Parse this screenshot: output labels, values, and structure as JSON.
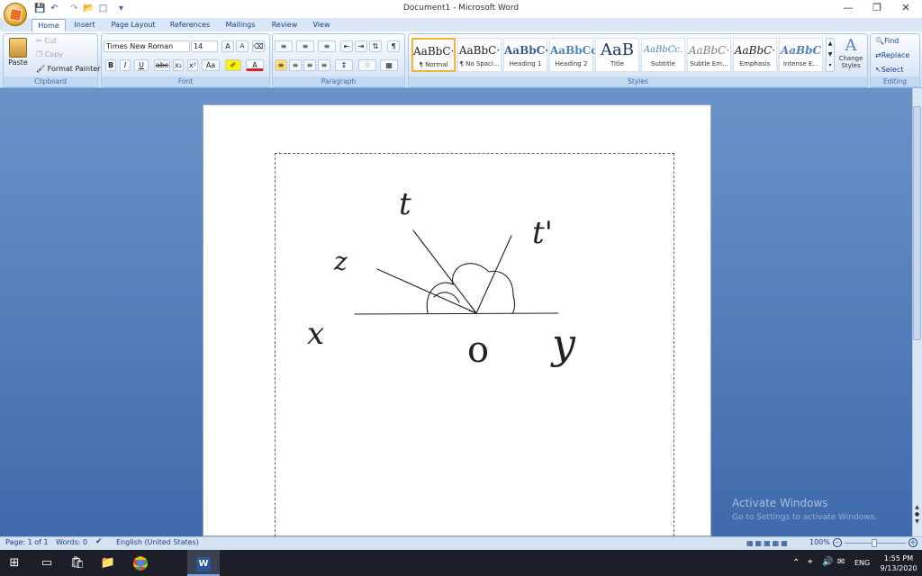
{
  "window": {
    "title": "Document1 - Microsoft Word"
  },
  "tabs": [
    "Home",
    "Insert",
    "Page Layout",
    "References",
    "Mailings",
    "Review",
    "View"
  ],
  "clipboard": {
    "paste": "Paste",
    "cut": "Cut",
    "copy": "Copy",
    "format_painter": "Format Painter",
    "label": "Clipboard"
  },
  "font": {
    "name": "Times New Roman",
    "size": "14",
    "label": "Font"
  },
  "paragraph": {
    "label": "Paragraph"
  },
  "styles": {
    "label": "Styles",
    "tiles": [
      {
        "sample": "AaBbC·",
        "name": "¶ Normal"
      },
      {
        "sample": "AaBbC·",
        "name": "¶ No Spaci..."
      },
      {
        "sample": "AaBbC·",
        "name": "Heading 1"
      },
      {
        "sample": "AaBbCc",
        "name": "Heading 2"
      },
      {
        "sample": "AaB",
        "name": "Title"
      },
      {
        "sample": "AaBbCc.",
        "name": "Subtitle"
      },
      {
        "sample": "AaBbC·",
        "name": "Subtle Em..."
      },
      {
        "sample": "AaBbC·",
        "name": "Emphasis"
      },
      {
        "sample": "AaBbC",
        "name": "Intense E..."
      }
    ],
    "change_styles": "Change Styles"
  },
  "editing": {
    "find": "Find",
    "replace": "Replace",
    "select": "Select",
    "label": "Editing"
  },
  "status": {
    "page": "Page: 1 of 1",
    "words": "Words: 0",
    "language": "English (United States)",
    "zoom": "100%"
  },
  "watermark": {
    "line1": "Activate Windows",
    "line2": "Go to Settings to activate Windows."
  },
  "taskbar": {
    "lang": "ENG",
    "time": "1:55 PM",
    "date": "9/13/2020"
  },
  "drawing_labels": {
    "x": "x",
    "y": "y",
    "z": "z",
    "o": "o",
    "t": "t",
    "t2": "t'"
  }
}
